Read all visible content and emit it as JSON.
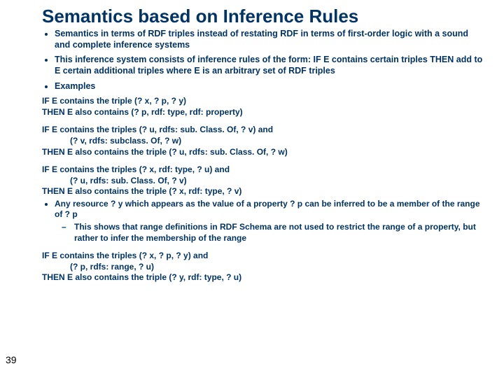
{
  "title": "Semantics based on Inference Rules",
  "bullets": {
    "b1": "Semantics in terms of RDF triples instead of restating RDF in terms of first-order logic with a sound and complete inference systems",
    "b2": "This inference system consists of inference rules of the form: IF E contains certain triples THEN add to E certain additional triples where E is an arbitrary set of RDF triples",
    "b3": "Examples"
  },
  "ex1": {
    "l1": "IF E contains the triple (? x, ? p, ? y)",
    "l2": "THEN E also contains (? p, rdf: type, rdf: property)"
  },
  "ex2": {
    "l1": "IF E contains the triples (? u, rdfs: sub. Class. Of, ? v) and",
    "l2": "(? v, rdfs: subclass. Of, ? w)",
    "l3": "THEN E also contains the triple (? u, rdfs: sub. Class. Of, ? w)"
  },
  "ex3": {
    "l1": "IF E contains the triples (? x, rdf: type, ? u) and",
    "l2": "(? u, rdfs: sub. Class. Of, ? v)",
    "l3": "THEN E also contains the triple (? x, rdf: type, ? v)",
    "inner": "Any resource ? y which appears as the value of a property ? p can be inferred to be a member of the range of ? p",
    "sub": "This shows that range definitions in RDF Schema are not used to restrict the range of a property, but rather to infer the membership of the range"
  },
  "ex4": {
    "l1": "IF E contains the triples (? x, ? p, ? y) and",
    "l2": "(? p, rdfs: range, ? u)",
    "l3": "THEN E also contains the triple (? y, rdf: type, ? u)"
  },
  "pagenum": "39"
}
